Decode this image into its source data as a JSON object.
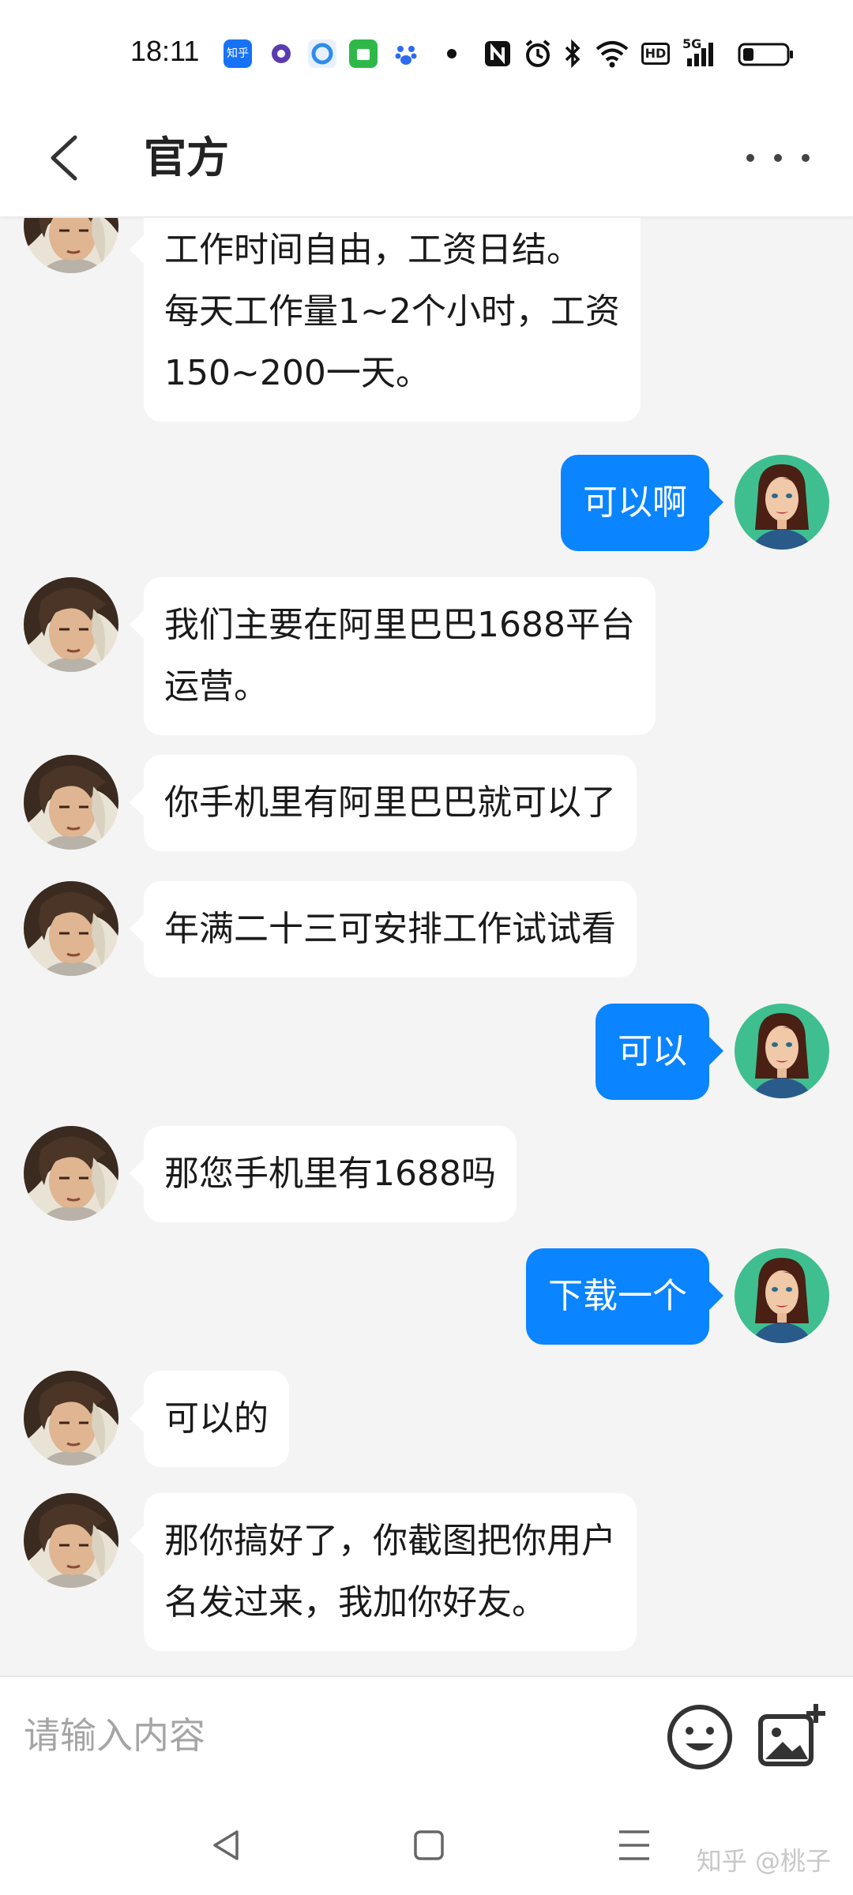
{
  "status_bar": {
    "time": "18:11",
    "icons": [
      "zhihu-app-icon",
      "purple-app-icon",
      "browser-app-icon",
      "green-app-icon",
      "baidu-app-icon",
      "dot-icon",
      "nfc-icon",
      "alarm-icon",
      "bluetooth-icon",
      "wifi-icon",
      "hd-icon",
      "signal-5g-icon",
      "battery-icon"
    ],
    "app_badge_zhihu": "知乎",
    "hd_label": "HD",
    "network_label": "5G"
  },
  "header": {
    "title": "官方"
  },
  "messages": [
    {
      "side": "left",
      "lines": [
        "工作时间自由，工资日结。",
        "每天工作量1~2个小时，工资",
        "150~200一天。"
      ]
    },
    {
      "side": "right",
      "lines": [
        "可以啊"
      ]
    },
    {
      "side": "left",
      "lines": [
        "我们主要在阿里巴巴1688平台",
        "运营。"
      ]
    },
    {
      "side": "left",
      "lines": [
        "你手机里有阿里巴巴就可以了"
      ]
    },
    {
      "side": "left",
      "lines": [
        "年满二十三可安排工作试试看"
      ]
    },
    {
      "side": "right",
      "lines": [
        "可以"
      ]
    },
    {
      "side": "left",
      "lines": [
        "那您手机里有1688吗"
      ]
    },
    {
      "side": "right",
      "lines": [
        "下载一个"
      ]
    },
    {
      "side": "left",
      "lines": [
        "可以的"
      ]
    },
    {
      "side": "left",
      "lines": [
        "那你搞好了，你截图把你用户",
        "名发过来，我加你好友。"
      ]
    }
  ],
  "input": {
    "placeholder": "请输入内容",
    "value": ""
  },
  "watermark": "知乎 @桃子",
  "colors": {
    "outgoing_bubble": "#0a84ff",
    "incoming_bubble": "#ffffff",
    "chat_background": "#f4f4f4"
  }
}
